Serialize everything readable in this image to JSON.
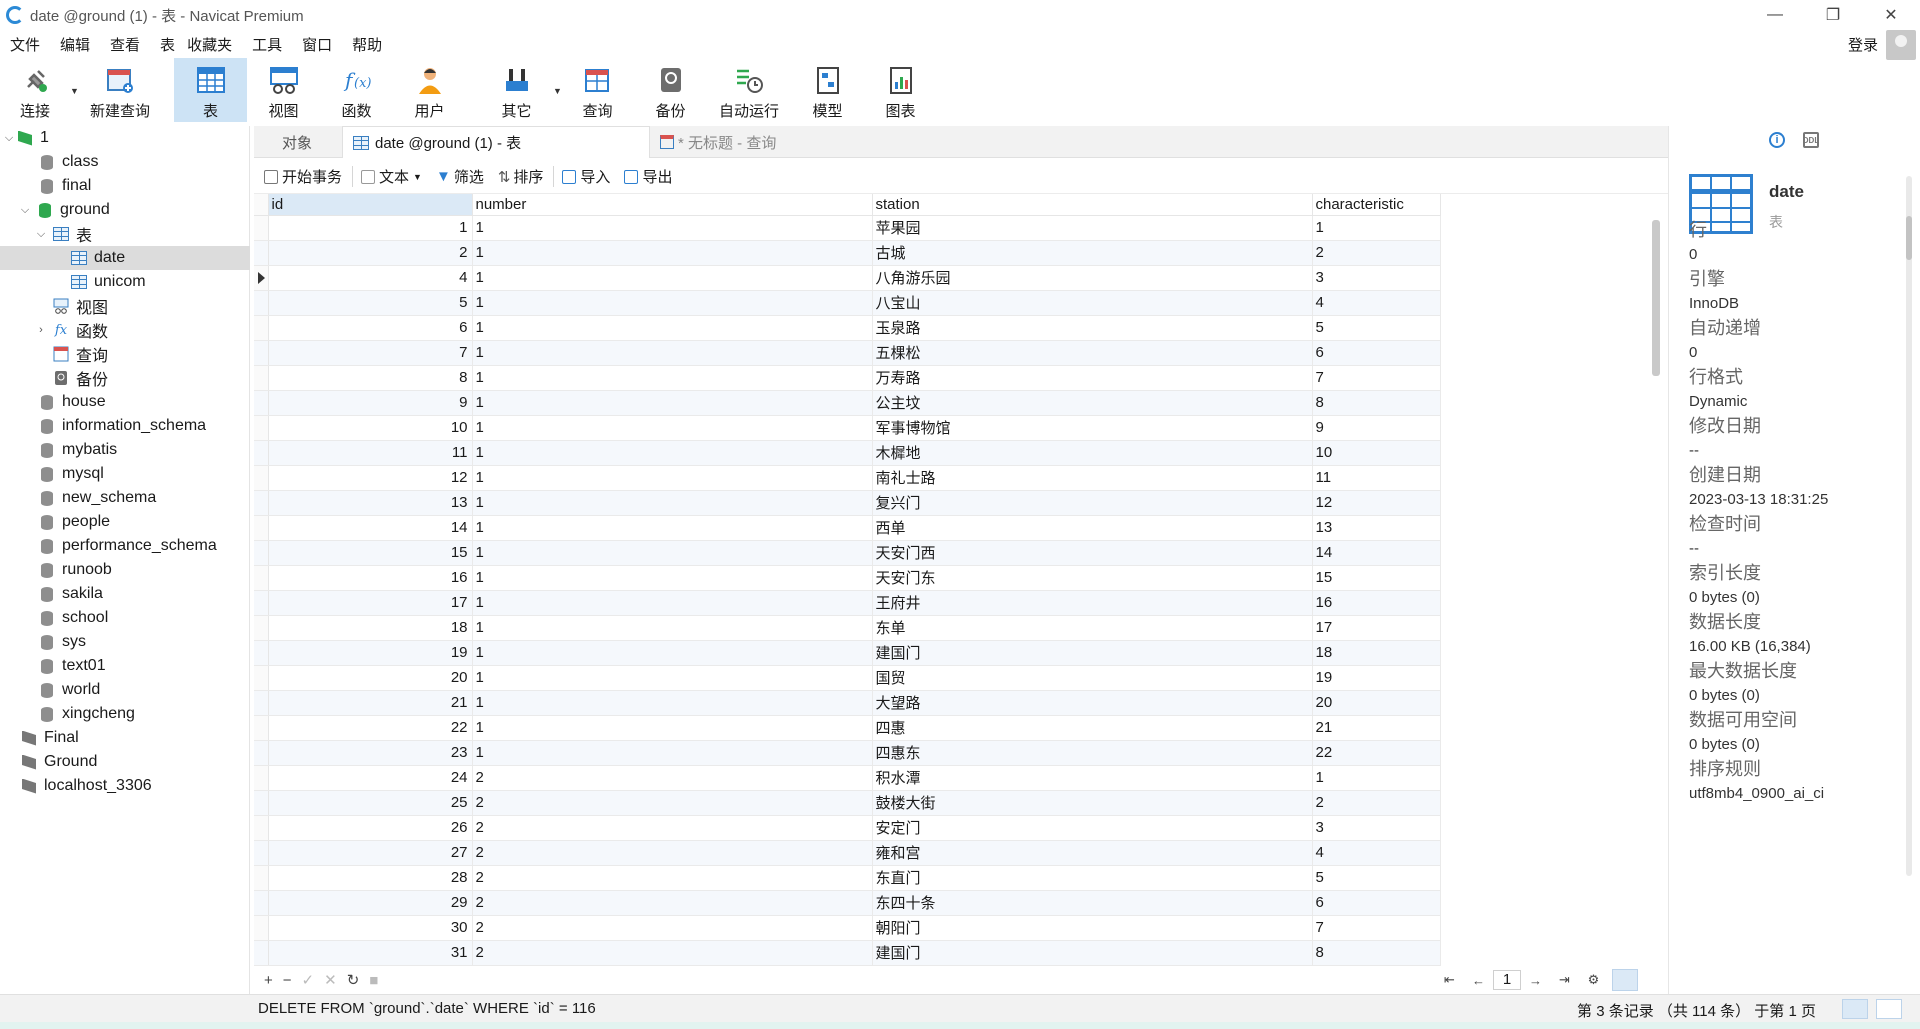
{
  "window": {
    "title": "date @ground (1) - 表 - Navicat Premium",
    "minimize": "—",
    "restore": "❐",
    "close": "✕"
  },
  "menu": [
    "文件",
    "编辑",
    "查看",
    "表",
    "收藏夹",
    "工具",
    "窗口",
    "帮助"
  ],
  "login": "登录",
  "toolbar": [
    {
      "label": "连接",
      "icon": "plug-icon"
    },
    {
      "label": "新建查询",
      "icon": "new-query-icon"
    },
    {
      "label": "表",
      "icon": "table-icon"
    },
    {
      "label": "视图",
      "icon": "view-icon"
    },
    {
      "label": "函数",
      "icon": "function-icon"
    },
    {
      "label": "用户",
      "icon": "user-icon"
    },
    {
      "label": "其它",
      "icon": "tools-icon"
    },
    {
      "label": "查询",
      "icon": "query-icon"
    },
    {
      "label": "备份",
      "icon": "backup-icon"
    },
    {
      "label": "自动运行",
      "icon": "schedule-icon"
    },
    {
      "label": "模型",
      "icon": "model-icon"
    },
    {
      "label": "图表",
      "icon": "chart-icon"
    }
  ],
  "tree": {
    "root": "1",
    "dbs_before": [
      "class",
      "final"
    ],
    "ground": "ground",
    "tables_folder": "表",
    "tables": [
      "date",
      "unicom"
    ],
    "views": "视图",
    "functions": "函数",
    "queries": "查询",
    "backups": "备份",
    "dbs_after": [
      "house",
      "information_schema",
      "mybatis",
      "mysql",
      "new_schema",
      "people",
      "performance_schema",
      "runoob",
      "sakila",
      "school",
      "sys",
      "text01",
      "world",
      "xingcheng"
    ],
    "connections": [
      "Final",
      "Ground",
      "localhost_3306"
    ]
  },
  "tabs": {
    "objects": "对象",
    "active": "date @ground (1) - 表",
    "inactive": "* 无标题 - 查询"
  },
  "tabletools": {
    "begin": "开始事务",
    "text": "文本",
    "filter": "筛选",
    "sort": "排序",
    "import": "导入",
    "export": "导出"
  },
  "grid": {
    "columns": [
      "id",
      "number",
      "station",
      "characteristic"
    ],
    "rows": [
      [
        "1",
        "1",
        "苹果园",
        "1"
      ],
      [
        "2",
        "1",
        "古城",
        "2"
      ],
      [
        "4",
        "1",
        "八角游乐园",
        "3"
      ],
      [
        "5",
        "1",
        "八宝山",
        "4"
      ],
      [
        "6",
        "1",
        "玉泉路",
        "5"
      ],
      [
        "7",
        "1",
        "五棵松",
        "6"
      ],
      [
        "8",
        "1",
        "万寿路",
        "7"
      ],
      [
        "9",
        "1",
        "公主坟",
        "8"
      ],
      [
        "10",
        "1",
        "军事博物馆",
        "9"
      ],
      [
        "11",
        "1",
        "木樨地",
        "10"
      ],
      [
        "12",
        "1",
        "南礼士路",
        "11"
      ],
      [
        "13",
        "1",
        "复兴门",
        "12"
      ],
      [
        "14",
        "1",
        "西单",
        "13"
      ],
      [
        "15",
        "1",
        "天安门西",
        "14"
      ],
      [
        "16",
        "1",
        "天安门东",
        "15"
      ],
      [
        "17",
        "1",
        "王府井",
        "16"
      ],
      [
        "18",
        "1",
        "东单",
        "17"
      ],
      [
        "19",
        "1",
        "建国门",
        "18"
      ],
      [
        "20",
        "1",
        "国贸",
        "19"
      ],
      [
        "21",
        "1",
        "大望路",
        "20"
      ],
      [
        "22",
        "1",
        "四惠",
        "21"
      ],
      [
        "23",
        "1",
        "四惠东",
        "22"
      ],
      [
        "24",
        "2",
        "积水潭",
        "1"
      ],
      [
        "25",
        "2",
        "鼓楼大街",
        "2"
      ],
      [
        "26",
        "2",
        "安定门",
        "3"
      ],
      [
        "27",
        "2",
        "雍和宫",
        "4"
      ],
      [
        "28",
        "2",
        "东直门",
        "5"
      ],
      [
        "29",
        "2",
        "东四十条",
        "6"
      ],
      [
        "30",
        "2",
        "朝阳门",
        "7"
      ],
      [
        "31",
        "2",
        "建国门",
        "8"
      ]
    ],
    "current_row_index": 2
  },
  "gridnav": {
    "add": "+",
    "remove": "−",
    "apply": "✓",
    "cancel": "✕",
    "refresh": "↻",
    "stop": "■",
    "page": "1",
    "first": "⇤",
    "prev": "←",
    "next": "→",
    "last": "⇥",
    "settings": "⚙"
  },
  "info": {
    "name": "date",
    "type": "表",
    "props": [
      {
        "k": "行",
        "v": "0"
      },
      {
        "k": "引擎",
        "v": "InnoDB"
      },
      {
        "k": "自动递增",
        "v": "0"
      },
      {
        "k": "行格式",
        "v": "Dynamic"
      },
      {
        "k": "修改日期",
        "v": "--"
      },
      {
        "k": "创建日期",
        "v": "2023-03-13 18:31:25"
      },
      {
        "k": "检查时间",
        "v": "--"
      },
      {
        "k": "索引长度",
        "v": "0 bytes (0)"
      },
      {
        "k": "数据长度",
        "v": "16.00 KB (16,384)"
      },
      {
        "k": "最大数据长度",
        "v": "0 bytes (0)"
      },
      {
        "k": "数据可用空间",
        "v": "0 bytes (0)"
      },
      {
        "k": "排序规则",
        "v": "utf8mb4_0900_ai_ci"
      }
    ]
  },
  "status": {
    "sql": "DELETE FROM `ground`.`date` WHERE `id` = 116",
    "records": "第 3 条记录 （共 114 条） 于第 1 页"
  },
  "colors": {
    "accent": "#2c7fd0",
    "selection": "#cde3f5",
    "db_green": "#2fa84f"
  }
}
